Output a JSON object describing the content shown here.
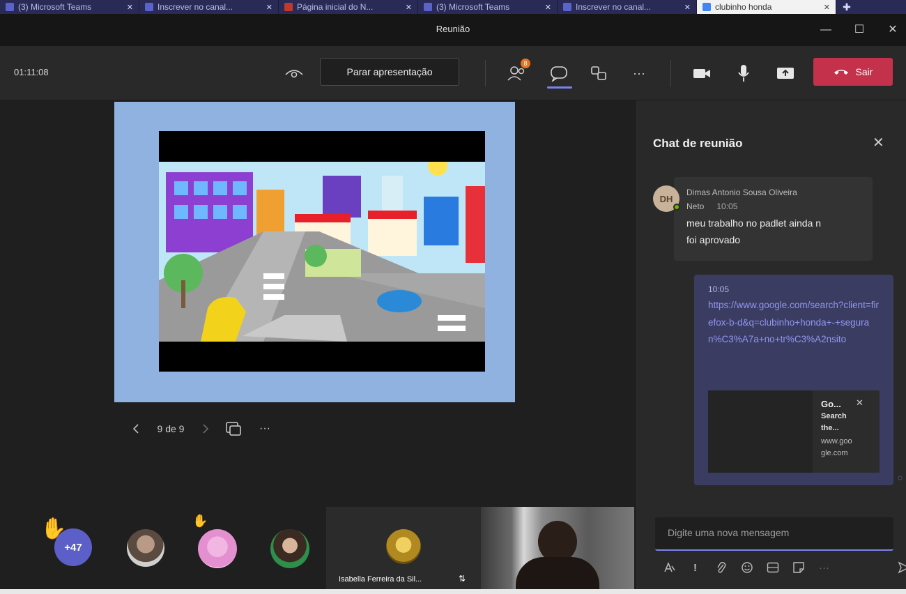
{
  "browser_tabs": [
    {
      "label": "(3) Microsoft Teams",
      "icon": "teams-icon",
      "active": false
    },
    {
      "label": "Inscrever no canal...",
      "icon": "teams-icon",
      "active": false
    },
    {
      "label": "Página inicial do N...",
      "icon": "app-icon",
      "active": false
    },
    {
      "label": "(3) Microsoft Teams",
      "icon": "teams-icon",
      "active": false
    },
    {
      "label": "Inscrever no canal...",
      "icon": "teams-icon",
      "active": false
    },
    {
      "label": "clubinho honda",
      "icon": "google-icon",
      "active": true
    }
  ],
  "window": {
    "title": "Reunião",
    "minimize": "—",
    "maximize": "☐",
    "close": "✕"
  },
  "toolbar": {
    "timer": "01:11:08",
    "stop_presenting_label": "Parar apresentação",
    "participants_badge": "8",
    "more_label": "···",
    "leave_label": "Sair"
  },
  "slide": {
    "counter": "9 de 9"
  },
  "participants": {
    "overflow_count": "+47",
    "video_tile_name": "Isabella Ferreira da Sil..."
  },
  "chat": {
    "title": "Chat de reunião",
    "messages": [
      {
        "initials": "DH",
        "author": "Dimas Antonio Sousa Oliveira",
        "author_cont": "Neto",
        "time": "10:05",
        "text_line1": "meu trabalho no padlet ainda n",
        "text_line2": "foi aprovado"
      }
    ],
    "own_message": {
      "time": "10:05",
      "link": "https://www.google.com/search?client=firefox-b-d&q=clubinho+honda+-+seguran%C3%A7a+no+tr%C3%A2nsito",
      "preview": {
        "title": "Go...",
        "description_line1": "Search",
        "description_line2": "the...",
        "domain_line1": "www.goo",
        "domain_line2": "gle.com"
      }
    },
    "compose_placeholder": "Digite uma nova mensagem"
  },
  "colors": {
    "accent": "#7b83eb",
    "leave": "#c4314b",
    "panel": "#292929",
    "badge": "#e8731f"
  }
}
